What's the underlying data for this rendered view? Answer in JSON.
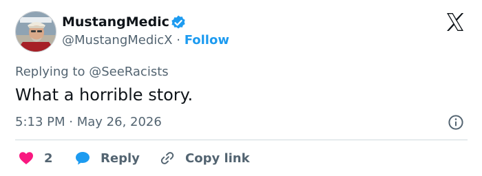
{
  "user": {
    "display_name": "MustangMedic",
    "handle": "@MustangMedicX",
    "separator": "·",
    "follow_label": "Follow",
    "verified": true
  },
  "reply": {
    "prefix": "Replying to",
    "mention": "@SeeRacists"
  },
  "tweet": {
    "text": "What a horrible story.",
    "time": "5:13 PM",
    "separator": "·",
    "date": "May 26, 2026"
  },
  "actions": {
    "like_count": "2",
    "reply_label": "Reply",
    "copy_label": "Copy link"
  },
  "icons": {
    "brand": "x-logo-icon",
    "verified": "verified-badge-icon",
    "info": "info-icon",
    "like": "heart-icon",
    "reply": "speech-bubble-icon",
    "copy": "link-icon"
  },
  "colors": {
    "accent": "#1d9bf0",
    "like": "#f91880",
    "text": "#0f1419",
    "muted": "#536471",
    "divider": "#cfd9de"
  }
}
